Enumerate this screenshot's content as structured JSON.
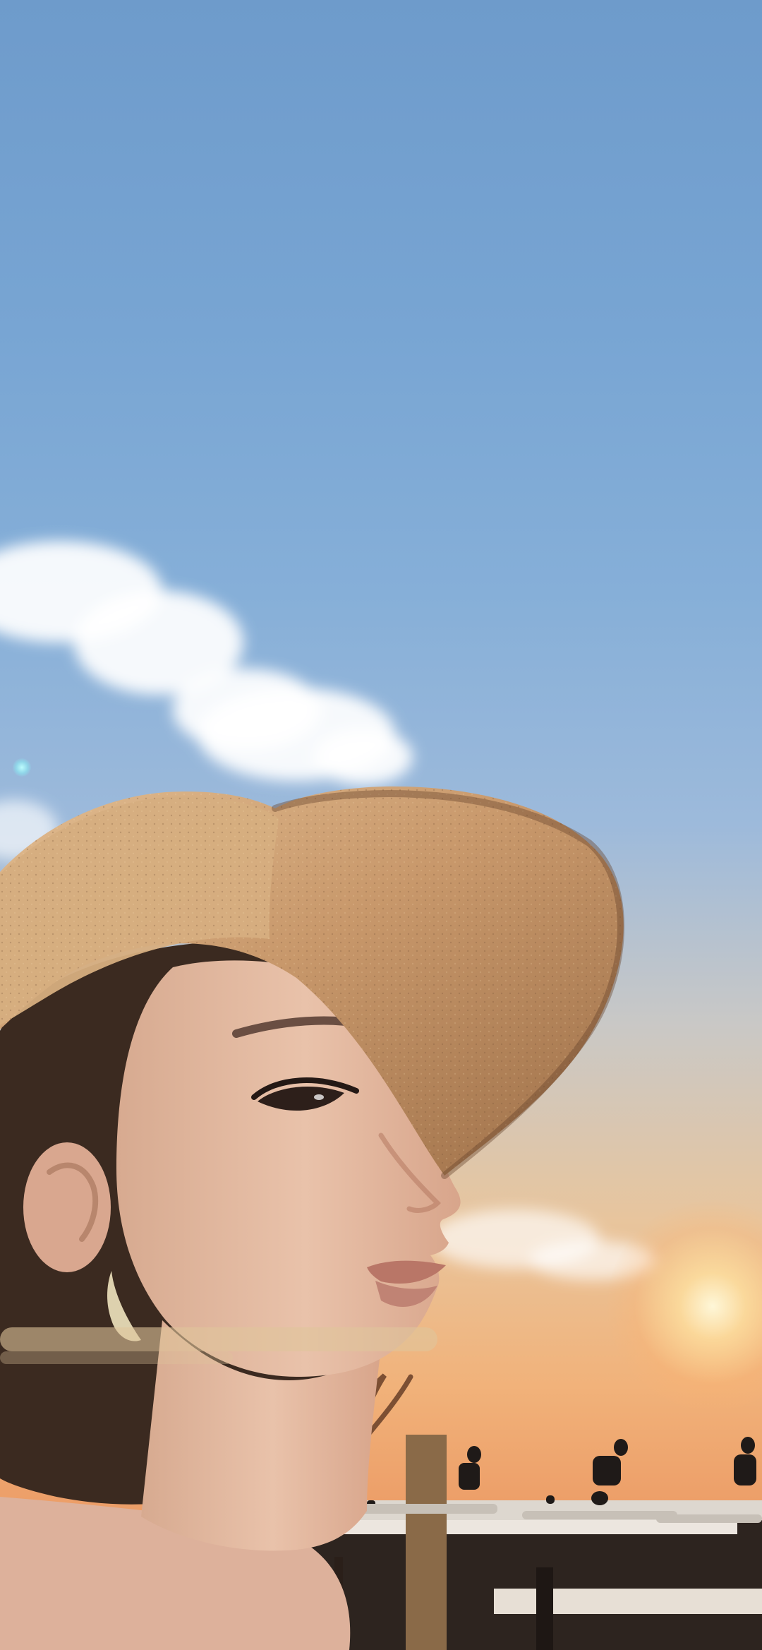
{
  "image": {
    "subject": "portrait",
    "colors": {
      "sky_top": "#6e9bcb",
      "sky_mid": "#9dbadb",
      "sunset": "#f1b27a",
      "sun": "#fff6d7",
      "hat": "#c89b6e",
      "skin": "#e2b69d",
      "hair": "#3b2a20"
    }
  }
}
